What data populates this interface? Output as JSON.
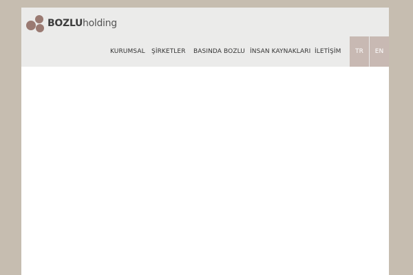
{
  "brand": {
    "name_bold": "BOZLU",
    "name_light": "holding",
    "logo_icon": "bozlu-logo-icon",
    "mark_color": "#9a7a72"
  },
  "nav": {
    "items": [
      {
        "label": "KURUMSAL"
      },
      {
        "label": "ŞİRKETLER"
      },
      {
        "label": "BASINDA BOZLU"
      },
      {
        "label": "İNSAN KAYNAKLARI"
      },
      {
        "label": "İLETİŞİM"
      }
    ]
  },
  "languages": [
    {
      "label": "TR"
    },
    {
      "label": "EN"
    }
  ],
  "colors": {
    "background": "#c6bdb0",
    "header": "#ebebea",
    "language_button": "#c8b9b3"
  }
}
